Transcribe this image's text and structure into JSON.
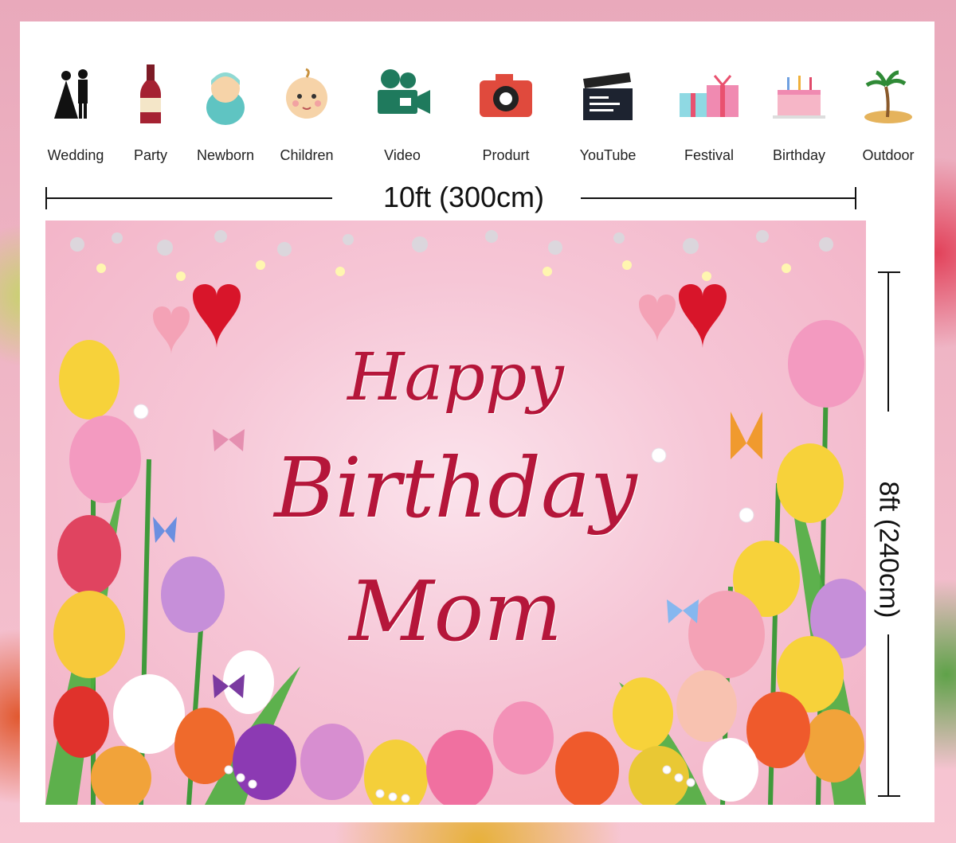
{
  "categories": [
    {
      "label": "Wedding",
      "icon": "wedding-couple-icon"
    },
    {
      "label": "Party",
      "icon": "wine-bottle-icon"
    },
    {
      "label": "Newborn",
      "icon": "newborn-baby-icon"
    },
    {
      "label": "Children",
      "icon": "child-face-icon"
    },
    {
      "label": "Video",
      "icon": "video-camera-icon"
    },
    {
      "label": "Produrt",
      "icon": "photo-camera-icon"
    },
    {
      "label": "YouTube",
      "icon": "clapperboard-icon"
    },
    {
      "label": "Festival",
      "icon": "gift-boxes-icon"
    },
    {
      "label": "Birthday",
      "icon": "birthday-cake-icon"
    },
    {
      "label": "Outdoor",
      "icon": "palm-island-icon"
    }
  ],
  "dimensions": {
    "width_label": "10ft (300cm)",
    "height_label": "8ft (240cm)"
  },
  "banner": {
    "line1": "Happy",
    "line2": "Birthday",
    "line3": "Mom",
    "text_color": "#b5163a",
    "background_color": "#f6c6d6"
  }
}
